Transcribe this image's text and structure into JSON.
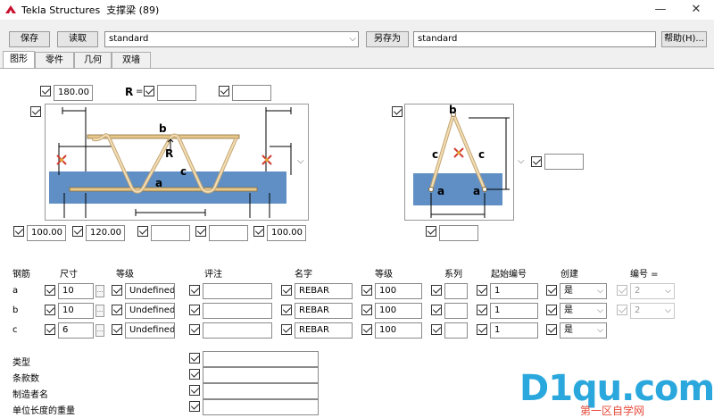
{
  "window": {
    "app_name": "Tekla Structures",
    "dialog_title": "支撑梁 (89)"
  },
  "toolbar": {
    "save_label": "保存",
    "load_label": "读取",
    "load_combo_value": "standard",
    "save_as_label": "另存为",
    "save_as_value": "standard",
    "help_label": "帮助(H)..."
  },
  "tabs": [
    {
      "label": "图形",
      "active": true
    },
    {
      "label": "零件",
      "active": false
    },
    {
      "label": "几何",
      "active": false
    },
    {
      "label": "双墙",
      "active": false
    }
  ],
  "picture": {
    "top_value": "180.00",
    "r_label": "R",
    "r_equals": "=",
    "r_value": "",
    "top_right_value": "",
    "bottom_values": [
      "100.00",
      "120.00",
      "",
      "",
      "100.00"
    ],
    "side_value": "",
    "side_bottom_value": "",
    "labels": {
      "b": "b",
      "R": "R",
      "c": "c",
      "a": "a"
    }
  },
  "table": {
    "headers": {
      "rebar": "钢筋",
      "size": "尺寸",
      "grade": "等级",
      "comment": "评注",
      "name": "名字",
      "class": "等级",
      "series": "系列",
      "start_number": "起始编号",
      "create": "创建",
      "numbering": "编号 ="
    },
    "rows": [
      {
        "id": "a",
        "size": "10",
        "grade": "Undefined",
        "comment": "",
        "name": "REBAR",
        "class": "100",
        "series": "",
        "start": "1",
        "create": "是",
        "numbering": "2",
        "numbering_enabled": true
      },
      {
        "id": "b",
        "size": "10",
        "grade": "Undefined",
        "comment": "",
        "name": "REBAR",
        "class": "100",
        "series": "",
        "start": "1",
        "create": "是",
        "numbering": "2",
        "numbering_enabled": true
      },
      {
        "id": "c",
        "size": "6",
        "grade": "Undefined",
        "comment": "",
        "name": "REBAR",
        "class": "100",
        "series": "",
        "start": "1",
        "create": "是",
        "numbering": "",
        "numbering_enabled": false
      }
    ],
    "browse_label": "..."
  },
  "extra": {
    "fields": [
      {
        "label": "类型",
        "value": ""
      },
      {
        "label": "条款数",
        "value": ""
      },
      {
        "label": "制造者名",
        "value": ""
      },
      {
        "label": "单位长度的重量",
        "value": ""
      }
    ]
  },
  "watermark": {
    "brand": "D1qu.com",
    "sub": "第一区自学网"
  },
  "icons": [
    "tekla-app-icon",
    "minimize-icon",
    "close-icon",
    "chevron-down-icon",
    "checkbox-icon"
  ],
  "colors": {
    "accent_red": "#c0392b",
    "water_blue": "#5f8fc4",
    "rebar_beige": "#e8c88a",
    "watermark_blue": "#2aa7dc"
  }
}
